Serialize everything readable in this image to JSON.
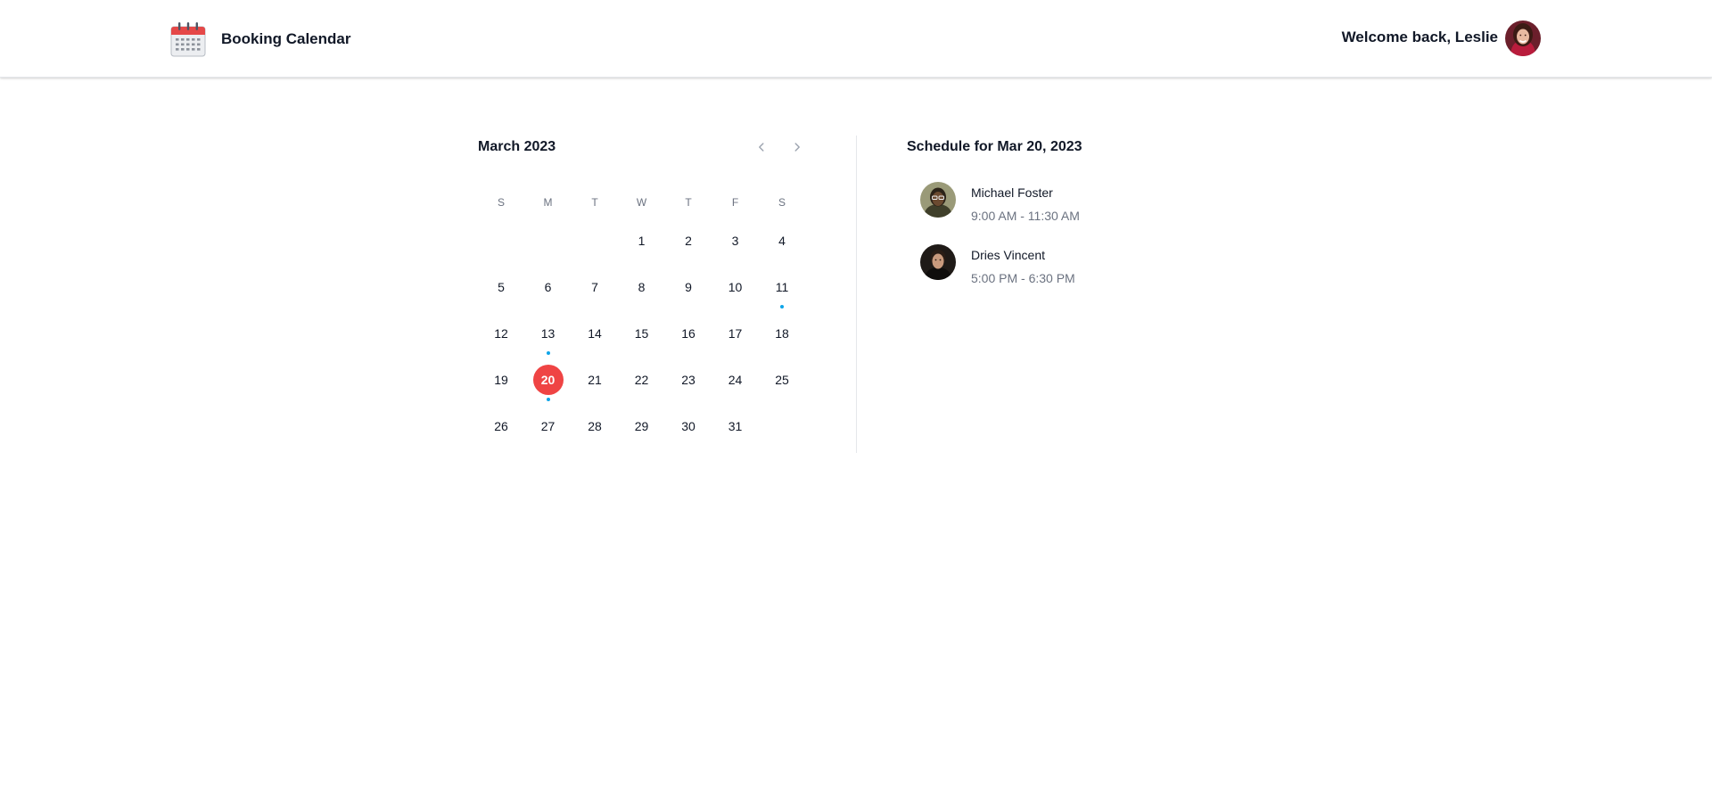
{
  "header": {
    "app_title": "Booking Calendar",
    "logo_icon": "calendar-icon",
    "welcome_text": "Welcome back, Leslie"
  },
  "calendar": {
    "month_label": "March 2023",
    "prev_icon": "chevron-left-icon",
    "next_icon": "chevron-right-icon",
    "weekdays": [
      "S",
      "M",
      "T",
      "W",
      "T",
      "F",
      "S"
    ],
    "weeks": [
      [
        "",
        "",
        "",
        "1",
        "2",
        "3",
        "4"
      ],
      [
        "5",
        "6",
        "7",
        "8",
        "9",
        "10",
        "11"
      ],
      [
        "12",
        "13",
        "14",
        "15",
        "16",
        "17",
        "18"
      ],
      [
        "19",
        "20",
        "21",
        "22",
        "23",
        "24",
        "25"
      ],
      [
        "26",
        "27",
        "28",
        "29",
        "30",
        "31",
        ""
      ]
    ],
    "selected_day": "20",
    "event_days": [
      "11",
      "13",
      "20"
    ]
  },
  "schedule": {
    "title": "Schedule for Mar 20, 2023",
    "meetings": [
      {
        "name": "Michael Foster",
        "time": "9:00 AM - 11:30 AM"
      },
      {
        "name": "Dries Vincent",
        "time": "5:00 PM - 6:30 PM"
      }
    ]
  },
  "colors": {
    "selected_day_bg": "#ef4444",
    "event_dot": "#0ea5e9",
    "muted_text": "#6b7280"
  }
}
